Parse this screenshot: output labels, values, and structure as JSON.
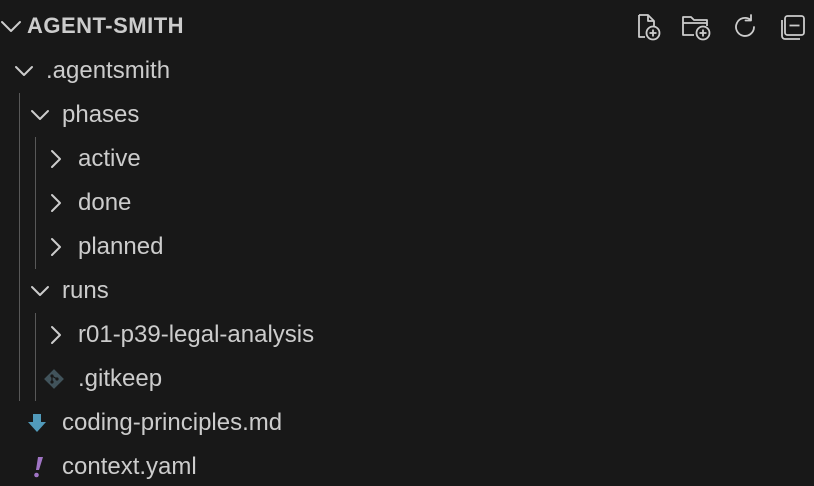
{
  "explorer": {
    "title": "AGENT-SMITH",
    "actions": {
      "new_file": "new-file-icon",
      "new_folder": "new-folder-icon",
      "refresh": "refresh-icon",
      "collapse_all": "collapse-all-icon"
    }
  },
  "tree": [
    {
      "label": ".agentsmith",
      "kind": "folder",
      "expanded": true
    },
    {
      "label": "phases",
      "kind": "folder",
      "expanded": true
    },
    {
      "label": "active",
      "kind": "folder",
      "expanded": false
    },
    {
      "label": "done",
      "kind": "folder",
      "expanded": false
    },
    {
      "label": "planned",
      "kind": "folder",
      "expanded": false
    },
    {
      "label": "runs",
      "kind": "folder",
      "expanded": true
    },
    {
      "label": "r01-p39-legal-analysis",
      "kind": "folder",
      "expanded": false
    },
    {
      "label": ".gitkeep",
      "kind": "file",
      "icon": "git-icon"
    },
    {
      "label": "coding-principles.md",
      "kind": "file",
      "icon": "markdown-icon"
    },
    {
      "label": "context.yaml",
      "kind": "file",
      "icon": "yaml-icon"
    }
  ],
  "colors": {
    "background": "#181818",
    "text": "#cccccc",
    "guide": "#585858",
    "markdown_icon": "#519aba",
    "yaml_icon": "#a074c4",
    "git_icon": "#41535b"
  }
}
